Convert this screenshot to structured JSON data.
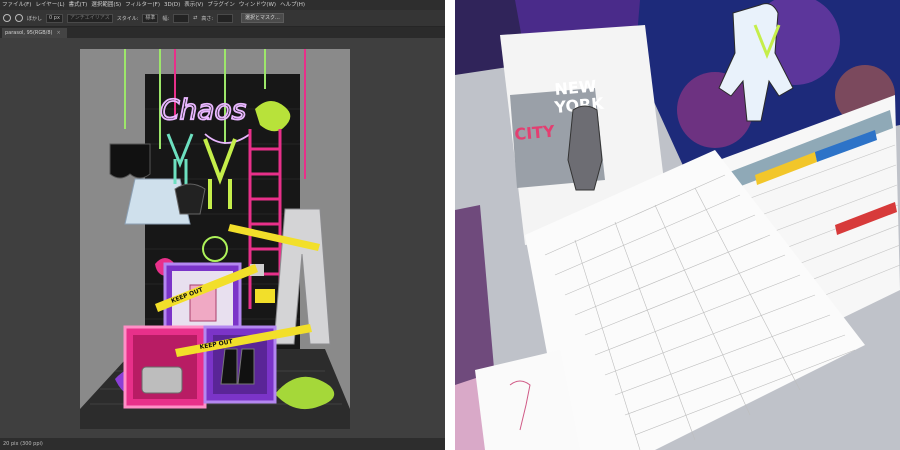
{
  "editor": {
    "menu": [
      "ファイル(F)",
      "レイヤー(L)",
      "書式(T)",
      "選択範囲(S)",
      "フィルター(F)",
      "3D(D)",
      "表示(V)",
      "プラグイン",
      "ウィンドウ(W)",
      "ヘルプ(H)"
    ],
    "options": {
      "sample_label": "ぼかし",
      "sample_value": "0 px",
      "antialias_label": "アンチエイリアス",
      "style_label": "スタイル:",
      "style_value": "標準",
      "width_label": "幅:",
      "height_label": "高さ:",
      "refine_button": "選択とマスク..."
    },
    "document_tab": "parasol, 95(RGB/8)",
    "status": "20 pix (300 ppi)"
  },
  "artwork": {
    "neon_text": "Chaos",
    "tape_text": "KEEP OUT",
    "colors": {
      "wall": "#171717",
      "neon": "#e9b7ff",
      "pink": "#e8308a",
      "purple": "#7b34c8",
      "lime": "#b8e23a",
      "tape": "#f2df2a"
    }
  },
  "photo": {
    "poster_texts": [
      "NEW",
      "YORK",
      "CITY"
    ]
  }
}
